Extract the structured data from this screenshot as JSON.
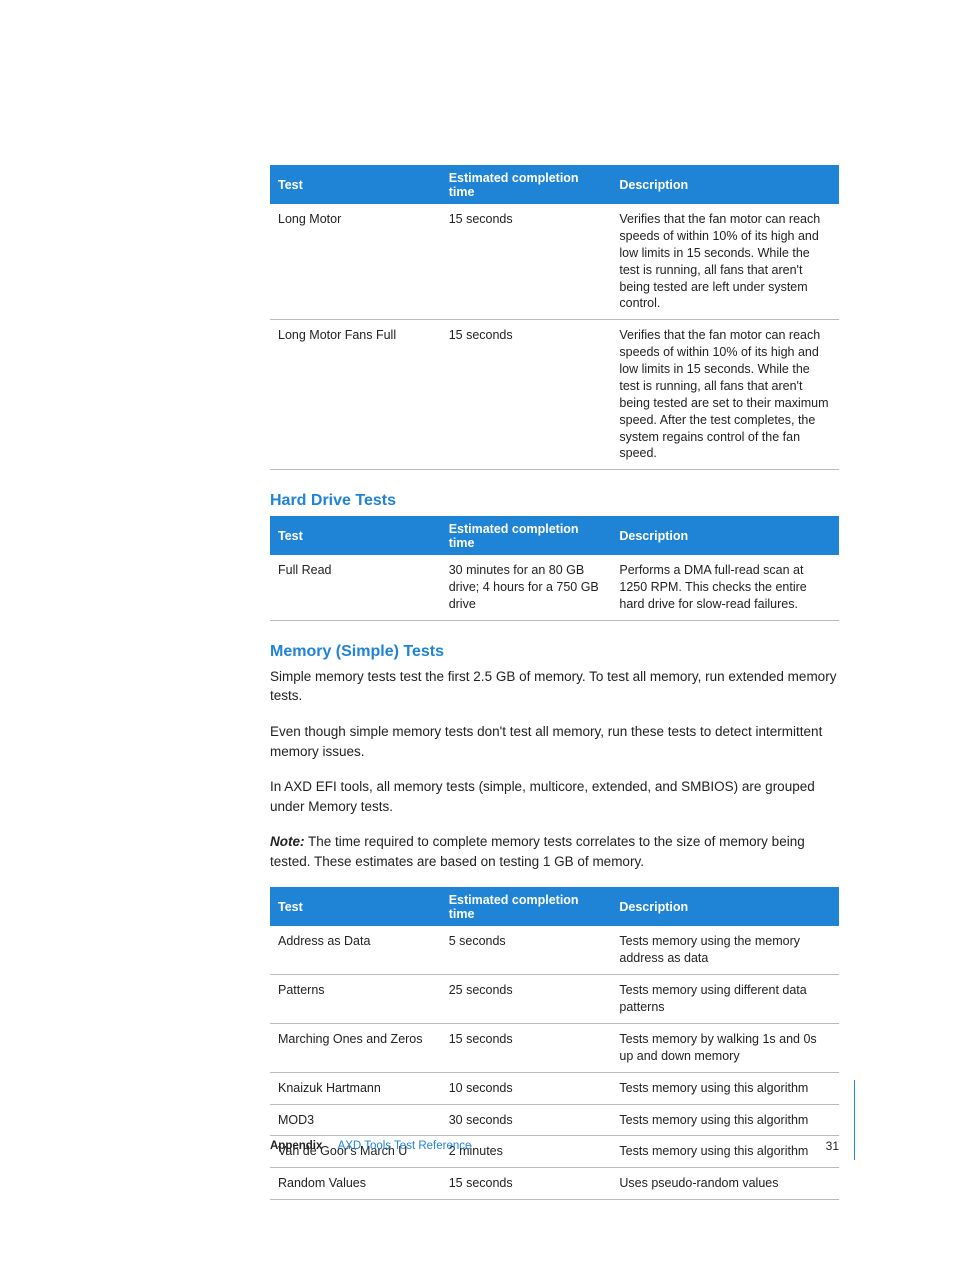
{
  "tables": {
    "fan": {
      "headers": [
        "Test",
        "Estimated completion time",
        "Description"
      ],
      "rows": [
        {
          "test": "Long Motor",
          "time": "15 seconds",
          "desc": "Verifies that the fan motor can reach speeds of within 10% of its high and low limits in 15 seconds. While the test is running, all fans that aren't being tested are left under system control."
        },
        {
          "test": "Long Motor Fans Full",
          "time": "15 seconds",
          "desc": "Verifies that the fan motor can reach speeds of within 10% of its high and low limits in 15 seconds. While the test is running, all fans that aren't being tested are set to their maximum speed. After the test completes, the system regains control of the fan speed."
        }
      ]
    },
    "hdd": {
      "heading": "Hard Drive Tests",
      "headers": [
        "Test",
        "Estimated completion time",
        "Description"
      ],
      "rows": [
        {
          "test": "Full Read",
          "time": "30 minutes for an 80 GB drive; 4 hours for a 750 GB drive",
          "desc": "Performs a DMA full-read scan at 1250 RPM. This checks the entire hard drive for slow-read failures."
        }
      ]
    },
    "memory": {
      "heading": "Memory (Simple) Tests",
      "para1": "Simple memory tests test the first 2.5 GB of memory. To test all memory, run extended memory tests.",
      "para2": "Even though simple memory tests don't test all memory, run these tests to detect intermittent memory issues.",
      "para3": "In AXD EFI tools, all memory tests (simple, multicore, extended, and SMBIOS) are grouped under Memory tests.",
      "note_label": "Note:",
      "note_body": "  The time required to complete memory tests correlates to the size of memory being tested. These estimates are based on testing 1 GB of memory.",
      "headers": [
        "Test",
        "Estimated completion time",
        "Description"
      ],
      "rows": [
        {
          "test": "Address as Data",
          "time": "5 seconds",
          "desc": "Tests memory using the memory address as data"
        },
        {
          "test": "Patterns",
          "time": "25 seconds",
          "desc": "Tests memory using different data patterns"
        },
        {
          "test": "Marching Ones and Zeros",
          "time": "15 seconds",
          "desc": "Tests memory by walking 1s and 0s up and down memory"
        },
        {
          "test": "Knaizuk Hartmann",
          "time": "10 seconds",
          "desc": "Tests memory using this algorithm"
        },
        {
          "test": "MOD3",
          "time": "30 seconds",
          "desc": "Tests memory using this algorithm"
        },
        {
          "test": "Van de Goor's March U",
          "time": "2 minutes",
          "desc": "Tests memory using this algorithm"
        },
        {
          "test": "Random Values",
          "time": "15 seconds",
          "desc": "Uses pseudo-random values"
        }
      ]
    }
  },
  "footer": {
    "appendix": "Appendix",
    "title": "AXD Tools Test Reference",
    "page": "31"
  }
}
